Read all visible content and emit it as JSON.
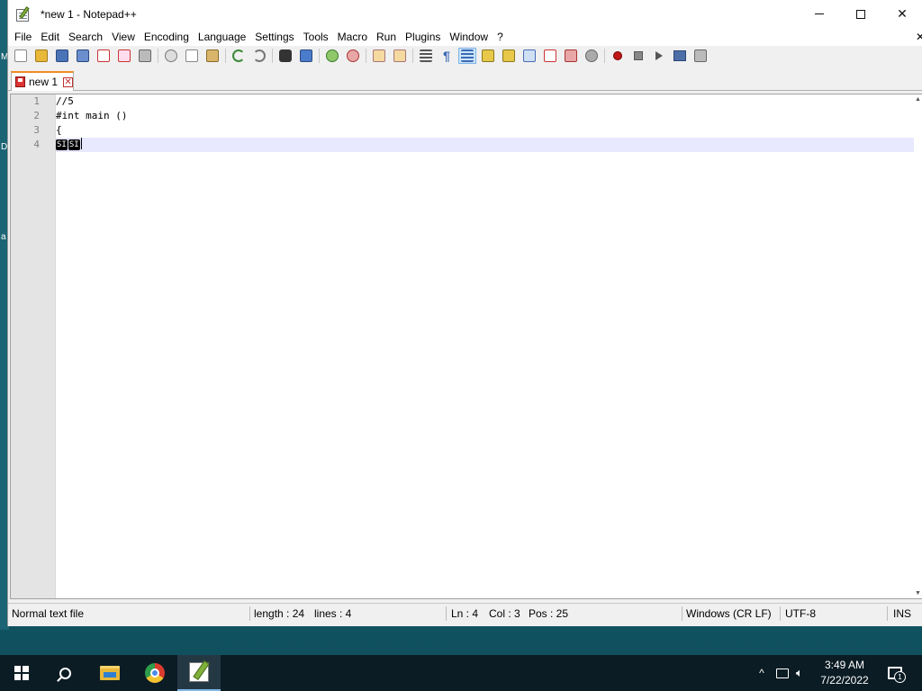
{
  "window": {
    "title": "*new 1 - Notepad++",
    "buttons": {
      "minimize": "—",
      "maximize": "□",
      "close": "✕"
    }
  },
  "menu": {
    "items": [
      "File",
      "Edit",
      "Search",
      "View",
      "Encoding",
      "Language",
      "Settings",
      "Tools",
      "Macro",
      "Run",
      "Plugins",
      "Window",
      "?"
    ],
    "close_glyph": "✕"
  },
  "tab": {
    "label": "new 1",
    "close_glyph": "✕"
  },
  "editor": {
    "line_numbers": [
      "1",
      "2",
      "3",
      "4"
    ],
    "lines": [
      "//5",
      "#int main ()",
      "{",
      ""
    ],
    "control_chars": [
      "SI",
      "SI"
    ]
  },
  "status": {
    "file_type": "Normal text file",
    "length": "length : 24",
    "lines": "lines : 4",
    "ln": "Ln : 4",
    "col": "Col : 3",
    "pos": "Pos : 25",
    "eol": "Windows (CR LF)",
    "encoding": "UTF-8",
    "mode": "INS"
  },
  "taskbar": {
    "clock_time": "3:49 AM",
    "clock_date": "7/22/2022",
    "tray_chevron": "^",
    "notification_count": "1"
  },
  "desktop": {
    "glyphs": [
      "M",
      "D",
      "a"
    ]
  },
  "colors": {
    "tab_accent": "#f08a24",
    "current_line": "#e8e8ff",
    "taskbar": "#0b1c24",
    "desktop": "#1a5f6e"
  }
}
